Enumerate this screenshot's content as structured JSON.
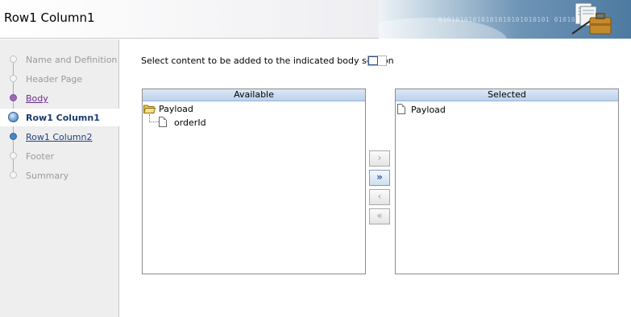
{
  "header": {
    "title": "Row1 Column1",
    "banner_binary": "01010101010101010101010101 010101010"
  },
  "train": {
    "steps": [
      {
        "label": "Name and Definition",
        "state": "disabled"
      },
      {
        "label": "Header Page",
        "state": "disabled"
      },
      {
        "label": "Body",
        "state": "visited"
      },
      {
        "label": "Row1 Column1",
        "state": "active"
      },
      {
        "label": "Row1 Column2",
        "state": "link"
      },
      {
        "label": "Footer",
        "state": "disabled"
      },
      {
        "label": "Summary",
        "state": "disabled"
      }
    ]
  },
  "main": {
    "instruction": "Select content to be added to the indicated body section",
    "available": {
      "header": "Available",
      "items": [
        {
          "label": "Payload",
          "icon": "folder-open-icon"
        },
        {
          "label": "orderId",
          "icon": "document-icon"
        }
      ]
    },
    "selected": {
      "header": "Selected",
      "items": [
        {
          "label": "Payload",
          "icon": "document-icon"
        }
      ]
    },
    "shuttle": {
      "move": "›",
      "move_all": "»",
      "remove": "‹",
      "remove_all": "«"
    }
  },
  "colors": {
    "accent": "#2b5aa0",
    "visited": "#6b2b8d",
    "panel_header": "#c8daf0"
  }
}
